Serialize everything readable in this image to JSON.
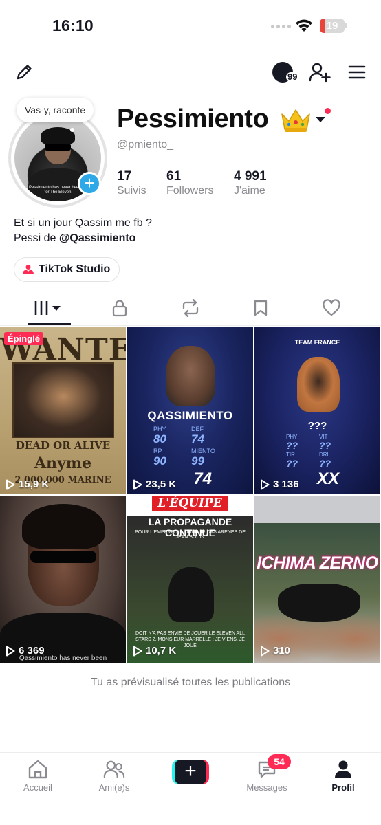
{
  "status_bar": {
    "time": "16:10",
    "battery_level": "19",
    "battery_fraction": 0.19,
    "battery_color": "#e8443a"
  },
  "toolbar": {
    "edit_icon": "pencil-icon",
    "story_count": "99",
    "add_friend_icon": "add-user-icon",
    "menu_icon": "hamburger-menu-icon"
  },
  "profile": {
    "bubble_text": "Vas-y, raconte",
    "display_name": "Pessimiento",
    "username": "@pmiento_",
    "avatar_caption": "Pessimiento has never been up for The Eleven",
    "stats": [
      {
        "value": "17",
        "label": "Suivis"
      },
      {
        "value": "61",
        "label": "Followers"
      },
      {
        "value": "4 991",
        "label": "J'aime"
      }
    ],
    "bio_line1": "Et si un jour Qassim me fb ?",
    "bio_line2_prefix": "Pessi de ",
    "bio_line2_tag": "@Qassimiento",
    "studio_label": "TikTok Studio"
  },
  "tabs": [
    {
      "name": "videos",
      "icon": "grid-icon",
      "active": true
    },
    {
      "name": "private",
      "icon": "lock-icon",
      "active": false
    },
    {
      "name": "reposts",
      "icon": "repost-icon",
      "active": false
    },
    {
      "name": "favorites",
      "icon": "bookmark-icon",
      "active": false
    },
    {
      "name": "liked",
      "icon": "heart-icon",
      "active": false
    }
  ],
  "videos": [
    {
      "views": "15,9 K",
      "pinned_label": "Épinglé",
      "wanted_title": "WANTED",
      "wanted_line1": "DEAD OR ALIVE",
      "wanted_line2": "Anyme",
      "wanted_line3": "2.000.000 MARINE"
    },
    {
      "views": "23,5 K",
      "card_name": "QASSIMIENTO",
      "card_stats": [
        {
          "label": "PHY",
          "value": "80"
        },
        {
          "label": "DEF",
          "value": "74"
        },
        {
          "label": "RP",
          "value": "90"
        },
        {
          "label": "MIENTO",
          "value": "99"
        }
      ],
      "card_big": "74"
    },
    {
      "views": "3 136",
      "team_label": "TEAM FRANCE",
      "card_name": "???",
      "card_stats": [
        {
          "label": "PHY",
          "value": "??"
        },
        {
          "label": "VIT",
          "value": "??"
        },
        {
          "label": "TIR",
          "value": "??"
        },
        {
          "label": "DRI",
          "value": "??"
        }
      ],
      "card_big": "XX"
    },
    {
      "views": "6 369",
      "caption": "Qassimiento has never been"
    },
    {
      "views": "10,7 K",
      "masthead": "L'ÉQUIPE",
      "headline": "LA PROPAGANDE CONTINUE",
      "subline": "POUR L'EMPEREUUUUUUUUR DES ARÈNES DE JEAN BOUIN",
      "footer": "DOIT N'A PAS ENVIE DE JOUER LE ELEVEN ALL STARS 2. MONSIEUR MARRELLE : JE VIENS, JE JOUE"
    },
    {
      "views": "310",
      "title": "ICHIMA ZERNO"
    }
  ],
  "footer_message": "Tu as prévisualisé toutes les publications",
  "bottom_nav": {
    "home": "Accueil",
    "friends": "Ami(e)s",
    "inbox": "Messages",
    "inbox_badge": "54",
    "profile": "Profil"
  },
  "colors": {
    "accent_red": "#fe2c55",
    "accent_cyan": "#25f4ee",
    "avatar_add": "#2ea8e6",
    "text_primary": "#161823",
    "text_secondary": "#8a8b91"
  }
}
